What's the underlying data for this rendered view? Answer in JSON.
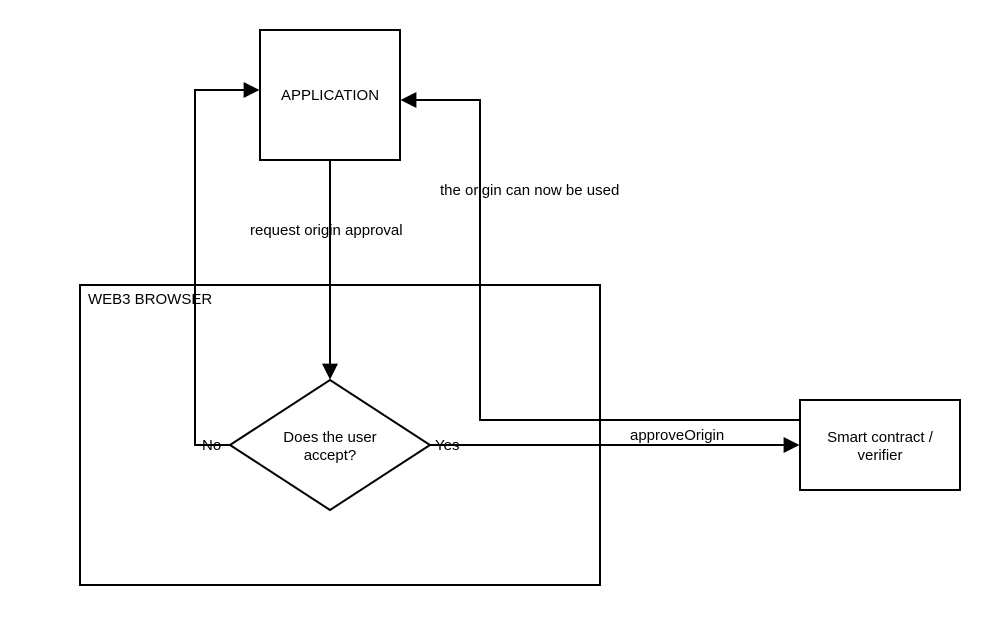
{
  "nodes": {
    "application": "APPLICATION",
    "decision_l1": "Does the user",
    "decision_l2": "accept?",
    "smart_l1": "Smart contract /",
    "smart_l2": "verifier",
    "container": "WEB3 BROWSER"
  },
  "edges": {
    "request": "request origin approval",
    "yes": "Yes",
    "no": "No",
    "approve": "approveOrigin",
    "canuse": "the origin can now be used"
  }
}
